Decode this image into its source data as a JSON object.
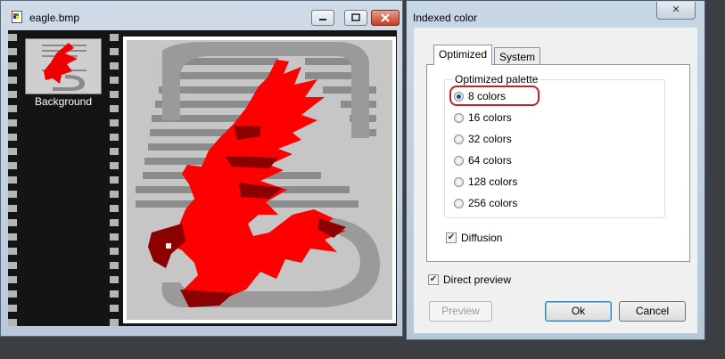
{
  "image_window": {
    "title": "eagle.bmp",
    "icon": "bitmap-file-icon",
    "layer": {
      "label": "Background"
    }
  },
  "dialog": {
    "title": "Indexed color",
    "tabs": [
      {
        "label": "Optimized",
        "selected": true
      },
      {
        "label": "System",
        "selected": false
      }
    ],
    "group_label": "Optimized palette",
    "palette_options": [
      {
        "label": "8 colors",
        "checked": true
      },
      {
        "label": "16 colors",
        "checked": false
      },
      {
        "label": "32 colors",
        "checked": false
      },
      {
        "label": "64 colors",
        "checked": false
      },
      {
        "label": "128 colors",
        "checked": false
      },
      {
        "label": "256 colors",
        "checked": false
      }
    ],
    "diffusion": {
      "label": "Diffusion",
      "checked": true
    },
    "direct_preview": {
      "label": "Direct preview",
      "checked": true
    },
    "buttons": {
      "preview": "Preview",
      "ok": "Ok",
      "cancel": "Cancel"
    }
  },
  "colors": {
    "eagle_red": "#ff0000",
    "eagle_dark_red": "#8b0000",
    "highlight": "#c4202a"
  }
}
